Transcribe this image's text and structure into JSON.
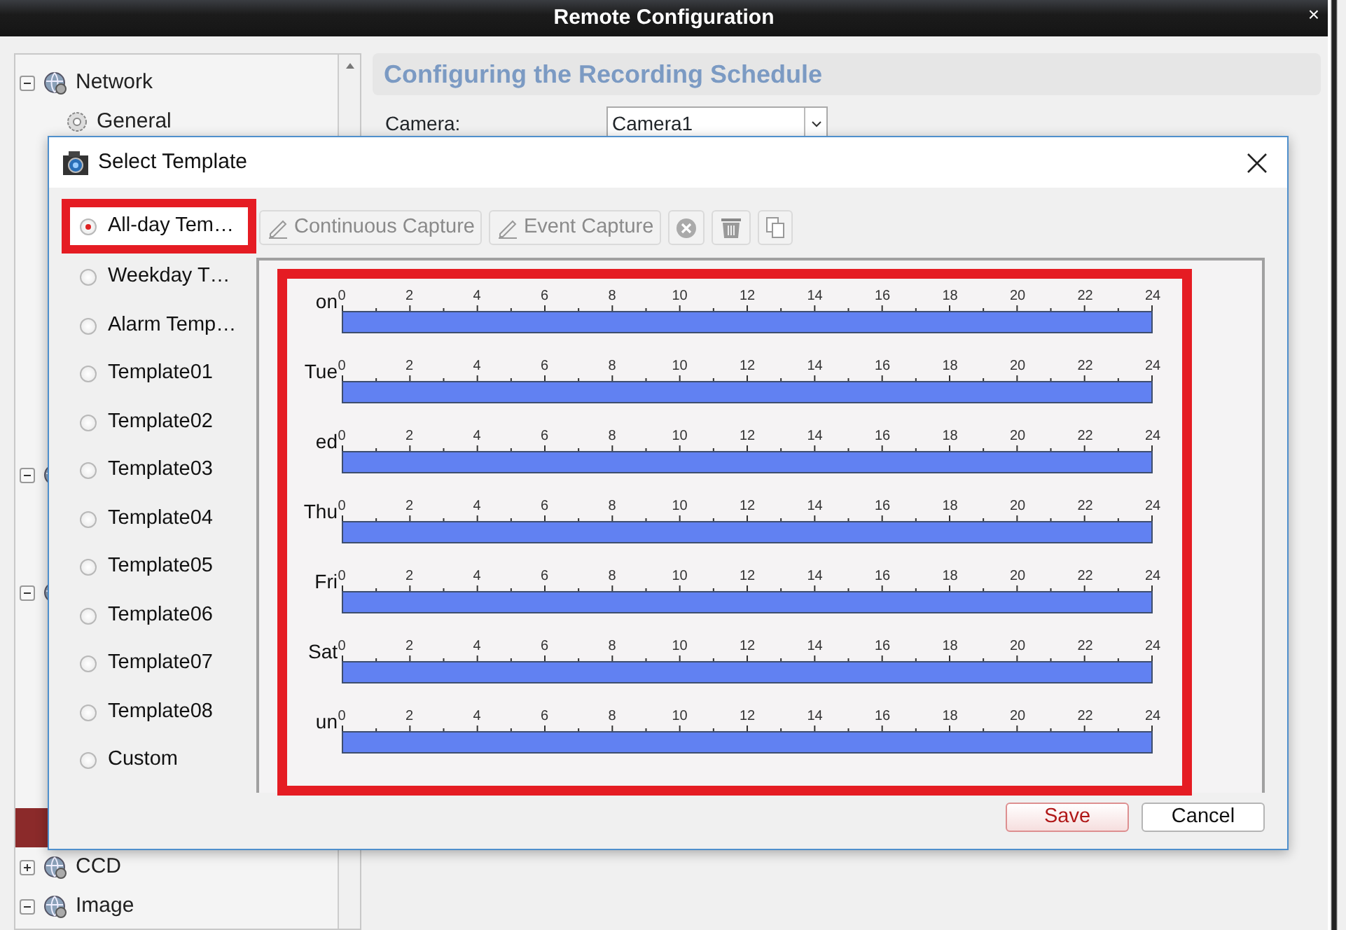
{
  "window": {
    "title": "Remote Configuration",
    "close": "×"
  },
  "tree": [
    {
      "label": "Network",
      "expanded": true,
      "kind": "group"
    },
    {
      "label": "General",
      "kind": "leaf"
    },
    {
      "expanded": true,
      "kind": "group"
    },
    {
      "expanded": true,
      "kind": "group"
    },
    {
      "selected": true,
      "kind": "leaf"
    },
    {
      "label": "CCD",
      "expanded": false,
      "kind": "group"
    },
    {
      "label": "Image",
      "expanded": true,
      "kind": "group"
    }
  ],
  "page": {
    "heading": "Configuring the Recording Schedule",
    "camera_label": "Camera:",
    "camera_value": "Camera1"
  },
  "dialog": {
    "title": "Select Template",
    "templates": [
      {
        "label": "All-day Tem…",
        "selected": true,
        "highlighted": true
      },
      {
        "label": "Weekday T…",
        "selected": false,
        "highlighted": false
      },
      {
        "label": "Alarm Temp…",
        "selected": false,
        "highlighted": false
      },
      {
        "label": "Template01",
        "selected": false,
        "highlighted": false
      },
      {
        "label": "Template02",
        "selected": false,
        "highlighted": false
      },
      {
        "label": "Template03",
        "selected": false,
        "highlighted": false
      },
      {
        "label": "Template04",
        "selected": false,
        "highlighted": false
      },
      {
        "label": "Template05",
        "selected": false,
        "highlighted": false
      },
      {
        "label": "Template06",
        "selected": false,
        "highlighted": false
      },
      {
        "label": "Template07",
        "selected": false,
        "highlighted": false
      },
      {
        "label": "Template08",
        "selected": false,
        "highlighted": false
      },
      {
        "label": "Custom",
        "selected": false,
        "highlighted": false
      }
    ],
    "toolbar": [
      {
        "kind": "pencil",
        "label": "Continuous Capture"
      },
      {
        "kind": "pencil",
        "label": "Event Capture"
      },
      {
        "kind": "clear"
      },
      {
        "kind": "delete"
      },
      {
        "kind": "copy"
      }
    ],
    "schedule": {
      "highlighted": true,
      "days": [
        {
          "label": "on",
          "level": 1,
          "hours": [
            "0",
            "2",
            "4",
            "6",
            "8",
            "10",
            "12",
            "14",
            "16",
            "18",
            "20",
            "22",
            "24"
          ]
        },
        {
          "label": "Tue",
          "level": 1,
          "hours": [
            "0",
            "2",
            "4",
            "6",
            "8",
            "10",
            "12",
            "14",
            "16",
            "18",
            "20",
            "22",
            "24"
          ]
        },
        {
          "label": "ed",
          "level": 1,
          "hours": [
            "0",
            "2",
            "4",
            "6",
            "8",
            "10",
            "12",
            "14",
            "16",
            "18",
            "20",
            "22",
            "24"
          ]
        },
        {
          "label": "Thu",
          "level": 1,
          "hours": [
            "0",
            "2",
            "4",
            "6",
            "8",
            "10",
            "12",
            "14",
            "16",
            "18",
            "20",
            "22",
            "24"
          ]
        },
        {
          "label": "Fri",
          "level": 1,
          "hours": [
            "0",
            "2",
            "4",
            "6",
            "8",
            "10",
            "12",
            "14",
            "16",
            "18",
            "20",
            "22",
            "24"
          ]
        },
        {
          "label": "Sat",
          "level": 1,
          "hours": [
            "0",
            "2",
            "4",
            "6",
            "8",
            "10",
            "12",
            "14",
            "16",
            "18",
            "20",
            "22",
            "24"
          ]
        },
        {
          "label": "un",
          "level": 1,
          "hours": [
            "0",
            "2",
            "4",
            "6",
            "8",
            "10",
            "12",
            "14",
            "16",
            "18",
            "20",
            "22",
            "24"
          ]
        }
      ]
    },
    "buttons": [
      {
        "kind": "primary",
        "label": "Save"
      },
      {
        "kind": "secondary",
        "label": "Cancel"
      }
    ]
  }
}
